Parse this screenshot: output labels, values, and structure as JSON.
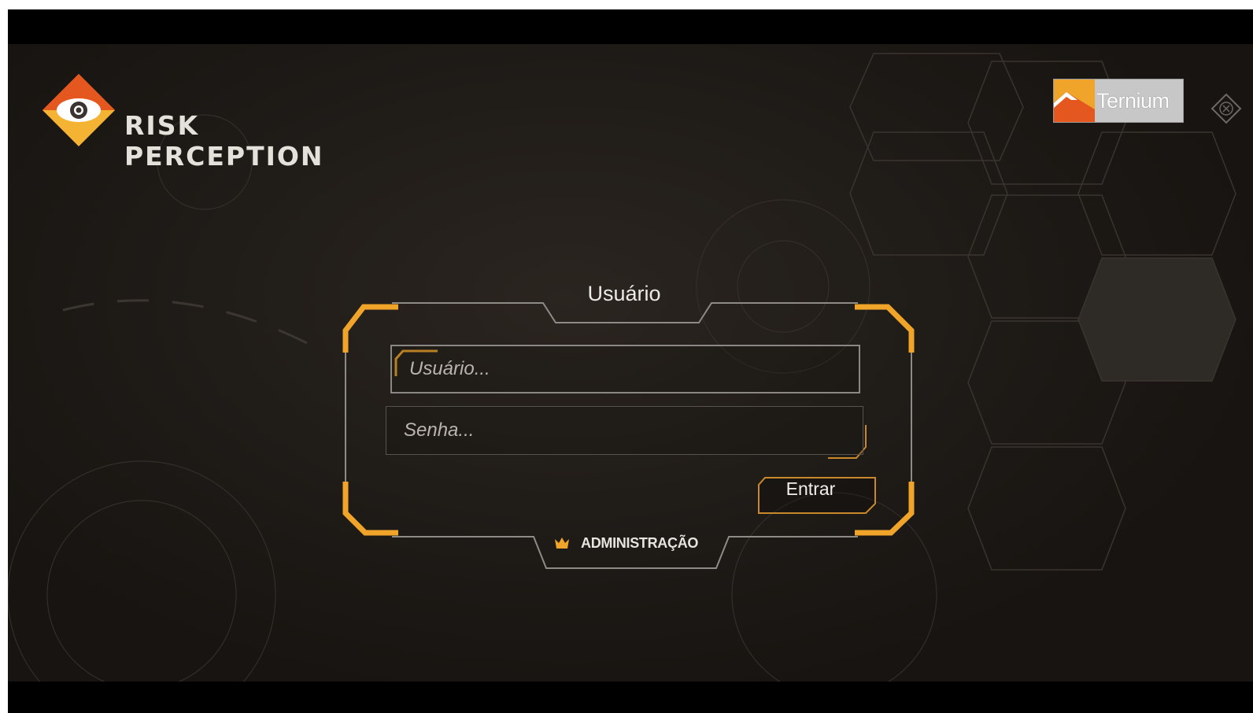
{
  "app": {
    "brand_line1": "RISK",
    "brand_line2": "PERCEPTION",
    "partner_name": "Ternium"
  },
  "login": {
    "title": "Usuário",
    "username_placeholder": "Usuário...",
    "password_placeholder": "Senha...",
    "username_value": "",
    "password_value": "",
    "submit_label": "Entrar",
    "admin_label": "ADMINISTRAÇÃO"
  },
  "colors": {
    "accent": "#f0a42a",
    "frame_line": "#8e8b87",
    "background": "#221e1a",
    "logo_orange": "#e4571f",
    "logo_yellow": "#f5b334"
  },
  "icons": [
    "risk-perception-eye-icon",
    "ternium-mountain-icon",
    "close-icon",
    "crown-icon"
  ]
}
